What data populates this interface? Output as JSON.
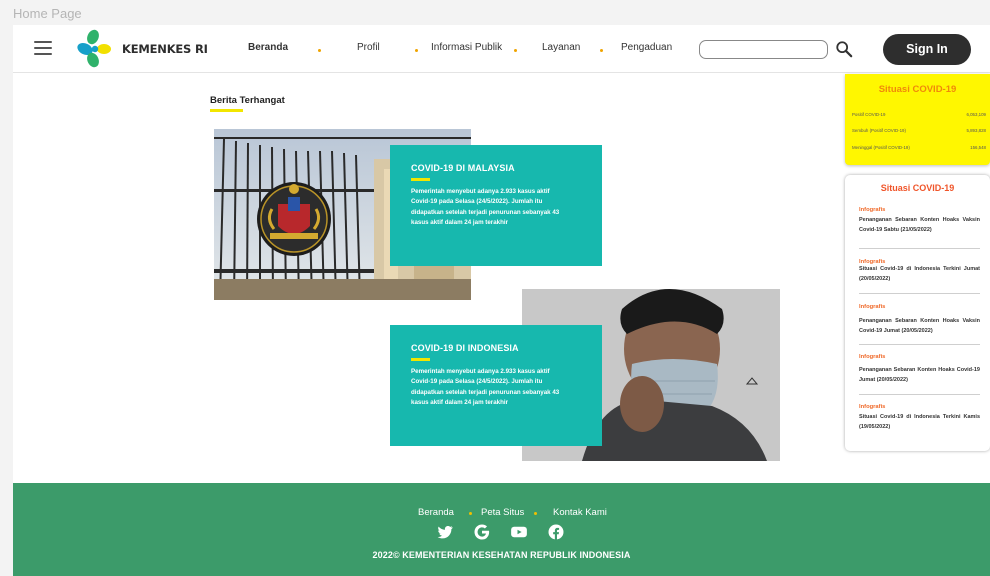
{
  "frame_label": "Home Page",
  "header": {
    "logo_text": "KEMENKES RI",
    "nav": [
      {
        "label": "Beranda"
      },
      {
        "label": "Profil"
      },
      {
        "label": "Informasi Publik"
      },
      {
        "label": "Layanan"
      },
      {
        "label": "Pengaduan"
      }
    ],
    "search": {
      "value": "",
      "placeholder": ""
    },
    "signin_label": "Sign In"
  },
  "main": {
    "section_title": "Berita Terhangat",
    "news": [
      {
        "title": "COVID-19 DI MALAYSIA",
        "body": "Pemerintah menyebut adanya 2.933 kasus aktif Covid-19 pada Selasa (24/5/2022). Jumlah itu didapatkan setelah terjadi penurunan sebanyak 43 kasus aktif dalam 24 jam terakhir"
      },
      {
        "title": "COVID-19 DI INDONESIA",
        "body": "Pemerintah menyebut adanya 2.933 kasus aktif Covid-19 pada Selasa (24/5/2022). Jumlah itu didapatkan setelah terjadi penurunan sebanyak 43 kasus aktif dalam 24 jam terakhir"
      }
    ]
  },
  "sidebar": {
    "stats": {
      "title": "Situasi COVID-19",
      "rows": [
        {
          "label": "Positif COVID-19",
          "value": "6,053,109"
        },
        {
          "label": "Sembuh (Positif COVID-19)",
          "value": "5,893,828"
        },
        {
          "label": "Meninggal (Positif COVID-19)",
          "value": "156,548"
        }
      ]
    },
    "list": {
      "title": "Situasi COVID-19",
      "items": [
        {
          "category": "Infografis",
          "text": "Penanganan Sebaran Konten Hoaks Vaksin Covid-19 Sabtu (21/05/2022)"
        },
        {
          "category": "Infografis",
          "text": "Situasi Covid-19 di Indonesia Terkini Jumat (20/05/2022)"
        },
        {
          "category": "Infografis",
          "text": "Penanganan Sebaran Konten Hoaks Vaksin Covid-19 Jumat (20/05/2022)"
        },
        {
          "category": "Infografis",
          "text": "Penanganan Sebaran Konten Hoaks Covid-19 Jumat (20/05/2022)"
        },
        {
          "category": "Infografis",
          "text": "Situasi Covid-19 di Indonesia Terkini Kamis (19/05/2022)"
        }
      ]
    }
  },
  "footer": {
    "links": [
      {
        "label": "Beranda"
      },
      {
        "label": "Peta Situs"
      },
      {
        "label": "Kontak Kami"
      }
    ],
    "social": [
      "twitter-icon",
      "google-icon",
      "youtube-icon",
      "facebook-icon"
    ],
    "copyright": "2022© KEMENTERIAN KESEHATAN REPUBLIK INDONESIA"
  },
  "colors": {
    "teal_card": "#17b8ae",
    "accent_yellow": "#f2e600",
    "footer_green": "#3c9b6a",
    "signin_dark": "#2e2e2e"
  }
}
